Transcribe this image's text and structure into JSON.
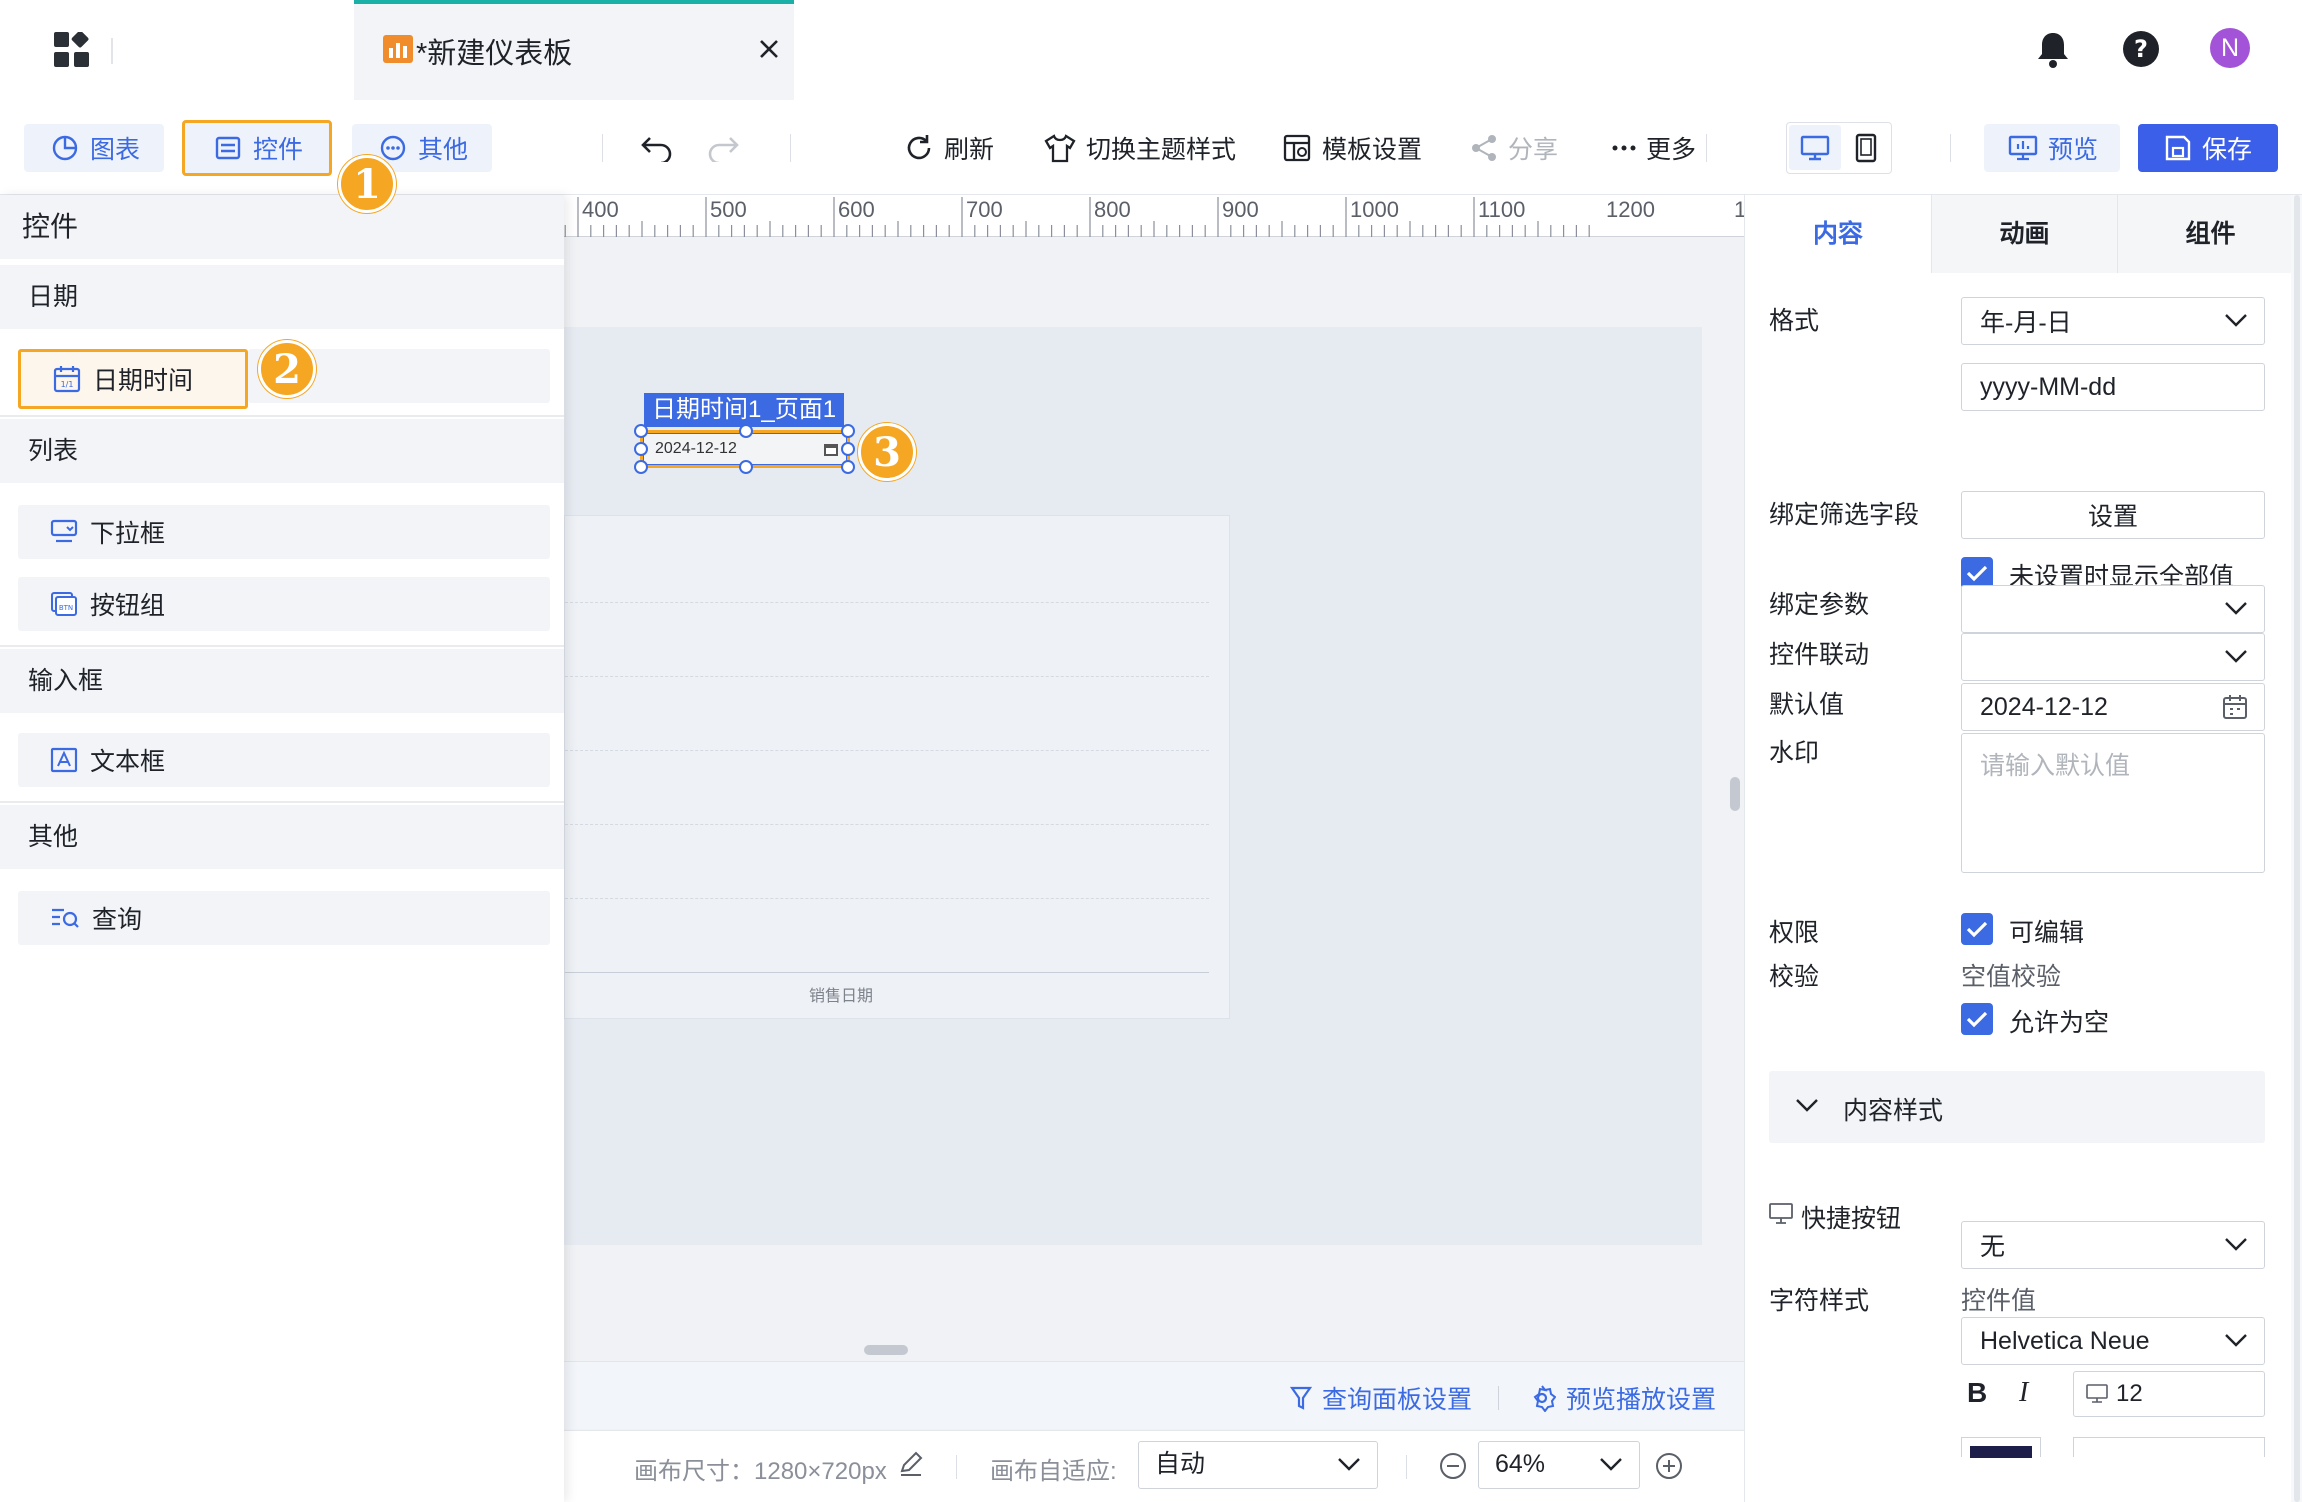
{
  "top": {
    "tab_title": "*新建仪表板",
    "avatar_letter": "N",
    "icons": [
      "apps-grid-icon",
      "dashboard-tab-icon",
      "close-icon",
      "bell-icon",
      "help-icon"
    ]
  },
  "toolbar": {
    "insert_tabs": [
      "图表",
      "控件",
      "其他"
    ],
    "refresh": "刷新",
    "switch_theme": "切换主题样式",
    "template_settings": "模板设置",
    "share": "分享",
    "more": "更多",
    "preview": "预览",
    "save": "保存"
  },
  "left_panel": {
    "title": "控件",
    "sections": [
      {
        "title": "日期",
        "items": [
          "日期时间"
        ]
      },
      {
        "title": "列表",
        "items": [
          "下拉框",
          "按钮组"
        ]
      },
      {
        "title": "输入框",
        "items": [
          "文本框"
        ]
      },
      {
        "title": "其他",
        "items": [
          "查询"
        ]
      }
    ]
  },
  "canvas": {
    "ruler_ticks": [
      "400",
      "500",
      "600",
      "700",
      "800",
      "900",
      "1000",
      "1100",
      "1200",
      "1"
    ],
    "widget_title": "日期时间1_页面1",
    "widget_value": "2024-12-12",
    "chart_axis_label": "销售日期",
    "query_panel_settings": "查询面板设置",
    "preview_play_settings": "预览播放设置",
    "canvas_size_label": "画布尺寸：1280×720px",
    "canvas_fit_label": "画布自适应:",
    "canvas_fit_value": "自动",
    "zoom_value": "64%"
  },
  "badges": [
    "1",
    "2",
    "3"
  ],
  "right_panel": {
    "tabs": [
      "内容",
      "动画",
      "组件"
    ],
    "active_tab": "内容",
    "format_label": "格式",
    "format_value": "年-月-日",
    "format_pattern": "yyyy-MM-dd",
    "bind_filter_label": "绑定筛选字段",
    "bind_filter_button": "设置",
    "show_all_label": "未设置时显示全部值",
    "bind_param_label": "绑定参数",
    "linkage_label": "控件联动",
    "default_label": "默认值",
    "default_value": "2024-12-12",
    "watermark_label": "水印",
    "watermark_placeholder": "请输入默认值",
    "permission_label": "权限",
    "editable_label": "可编辑",
    "validation_label": "校验",
    "null_validation": "空值校验",
    "allow_null_label": "允许为空",
    "content_style_label": "内容样式",
    "shortcut_label": "快捷按钮",
    "shortcut_value": "无",
    "char_style_label": "字符样式",
    "control_value_label": "控件值",
    "font_value": "Helvetica Neue",
    "bold": "B",
    "italic": "I",
    "font_size": "12"
  },
  "colors": {
    "accent": "#3b6ae3",
    "highlight": "#f5a623",
    "save_bg": "#3b5fe8"
  }
}
